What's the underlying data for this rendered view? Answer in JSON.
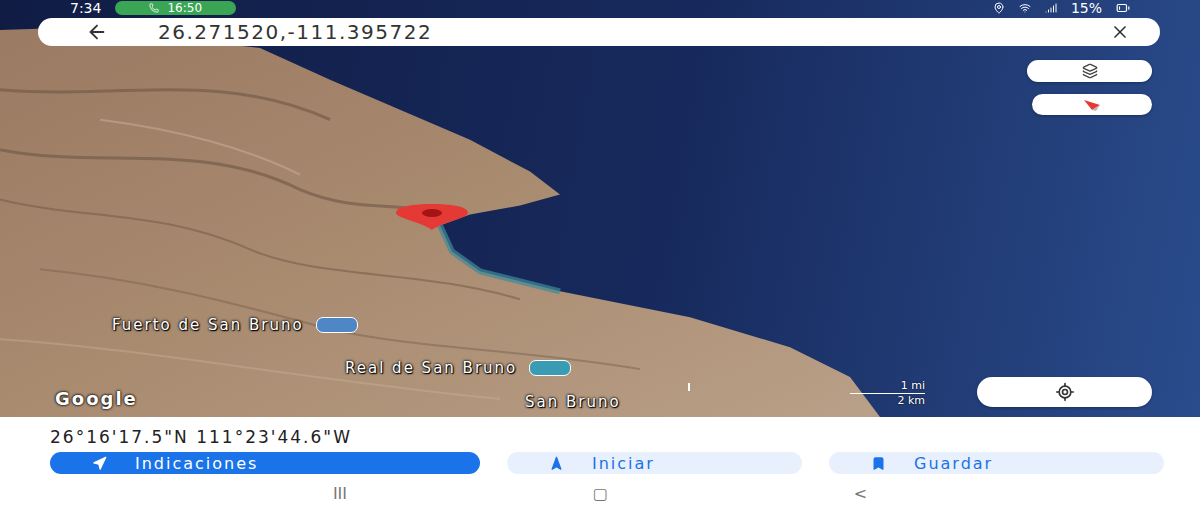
{
  "status_bar": {
    "time": "7:34",
    "call_time": "16:50",
    "battery": "15%"
  },
  "search": {
    "value": "26.271520,-111.395722"
  },
  "map": {
    "labels": [
      {
        "text": "Fuerto de San Bruno",
        "kind": "landmark"
      },
      {
        "text": "Real de San Bruno",
        "kind": "restaurant"
      },
      {
        "text": "San Bruno",
        "kind": "town"
      }
    ],
    "attribution": "Google",
    "scale": [
      "1 mi",
      "2 km"
    ]
  },
  "place": {
    "coordinates": "26°16'17.5\"N 111°23'44.6\"W"
  },
  "actions": [
    {
      "label": "Indicaciones",
      "selected": true
    },
    {
      "label": "Iniciar",
      "selected": false
    },
    {
      "label": "Guardar",
      "selected": false
    }
  ],
  "nav_buttons": [
    "III",
    "▢",
    "<"
  ]
}
